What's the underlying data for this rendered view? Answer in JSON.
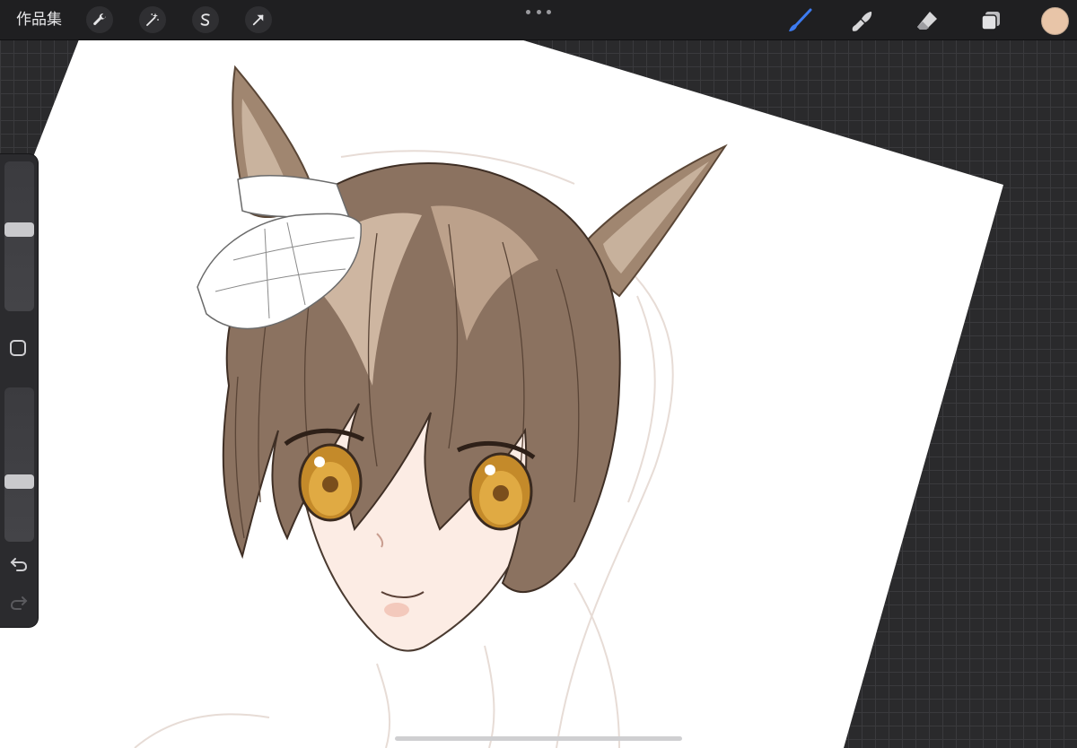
{
  "topbar": {
    "gallery_label": "作品集",
    "actions": [
      {
        "icon": "wrench-icon"
      },
      {
        "icon": "magic-wand-icon"
      },
      {
        "icon": "selection-icon"
      },
      {
        "icon": "transform-arrow-icon"
      }
    ],
    "more_icon": "ellipsis-icon",
    "tools": [
      {
        "icon": "brush-icon",
        "active": true
      },
      {
        "icon": "smudge-icon",
        "active": false
      },
      {
        "icon": "eraser-icon",
        "active": false
      },
      {
        "icon": "layers-icon",
        "active": false
      }
    ]
  },
  "colors": {
    "current_color": "#e8c5a8",
    "active_tool": "#3d7bf0"
  },
  "sidebar": {
    "brush_size_level": 0.55,
    "opacity_level": 0.38,
    "modify_icon": "square-icon",
    "undo_icon": "undo-icon",
    "redo_icon": "redo-icon"
  }
}
